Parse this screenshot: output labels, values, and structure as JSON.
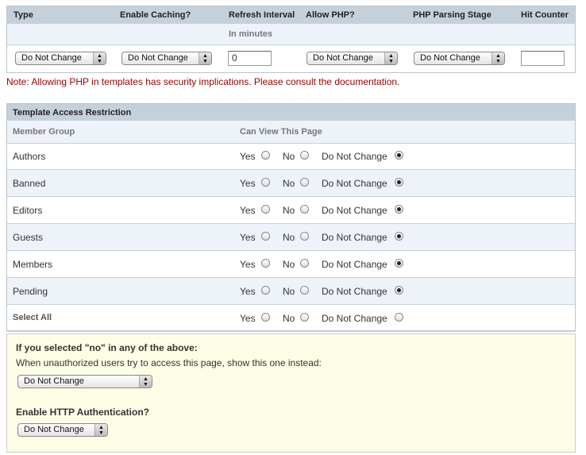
{
  "settings": {
    "headers": [
      "Type",
      "Enable Caching?",
      "Refresh Interval",
      "Allow PHP?",
      "PHP Parsing Stage",
      "Hit Counter"
    ],
    "refresh_unit": "In minutes",
    "type_select": "Do Not Change",
    "caching_select": "Do Not Change",
    "refresh_value": "0",
    "php_select": "Do Not Change",
    "stage_select": "Do Not Change",
    "hit_counter_value": ""
  },
  "note": "Note: Allowing PHP in templates has security implications. Please consult the documentation.",
  "access": {
    "title": "Template Access Restriction",
    "col_group": "Member Group",
    "col_view": "Can View This Page",
    "opt_yes": "Yes",
    "opt_no": "No",
    "opt_dnc": "Do Not Change",
    "rows": [
      {
        "group": "Authors",
        "selected": "dnc"
      },
      {
        "group": "Banned",
        "selected": "dnc"
      },
      {
        "group": "Editors",
        "selected": "dnc"
      },
      {
        "group": "Guests",
        "selected": "dnc"
      },
      {
        "group": "Members",
        "selected": "dnc"
      },
      {
        "group": "Pending",
        "selected": "dnc"
      }
    ],
    "select_all": "Select All"
  },
  "unauth": {
    "heading": "If you selected \"no\" in any of the above:",
    "desc": "When unauthorized users try to access this page, show this one instead:",
    "select": "Do Not Change",
    "http_heading": "Enable HTTP Authentication?",
    "http_select": "Do Not Change"
  },
  "colors": {
    "note": "#990000",
    "header": "#c5d1da",
    "alt_row": "#eef3fa",
    "notice_bg": "#fdfde6"
  }
}
